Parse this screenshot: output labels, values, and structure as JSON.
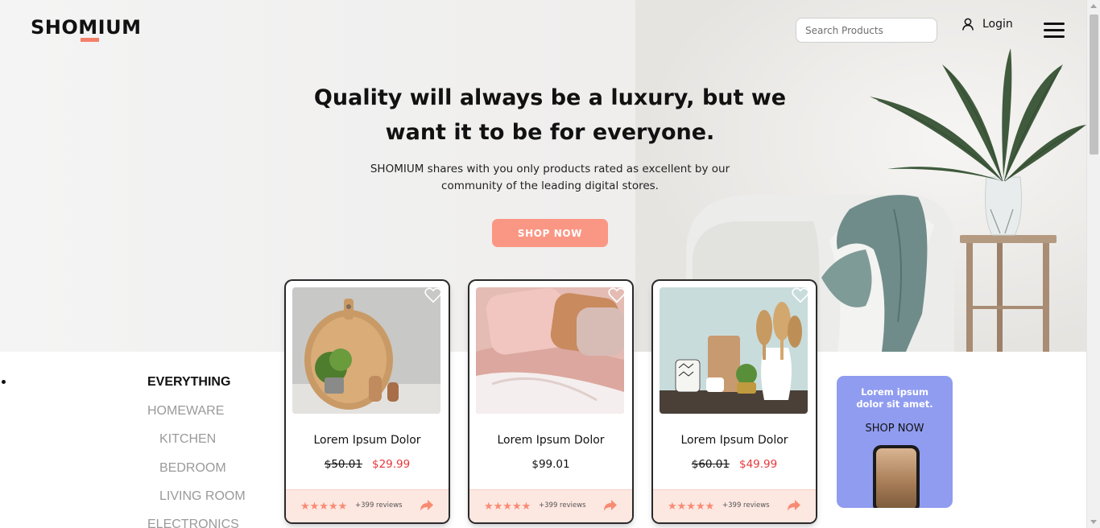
{
  "brand": {
    "name": "SHOMIUM",
    "accent": "#f4806a"
  },
  "header": {
    "search_placeholder": "Search Products",
    "login_label": "Login"
  },
  "hero": {
    "headline": "Quality will always be a luxury, but we want it to be for everyone.",
    "subtext": "SHOMIUM shares with you only products rated as excellent by our community of the leading digital stores.",
    "cta_label": "SHOP NOW",
    "cta_color": "#fa9784"
  },
  "categories": [
    {
      "label": "EVERYTHING",
      "active": true
    },
    {
      "label": "HOMEWARE",
      "active": false
    },
    {
      "label": "KITCHEN",
      "active": false
    },
    {
      "label": "BEDROOM",
      "active": false
    },
    {
      "label": "LIVING ROOM",
      "active": false
    },
    {
      "label": "ELECTRONICS",
      "active": false
    }
  ],
  "products": [
    {
      "title": "Lorem Ipsum Dolor",
      "old_price": "$50.01",
      "price": "$29.99",
      "rating_stars": "★★★★★",
      "reviews": "+399 reviews",
      "image": "cutting-board-plant"
    },
    {
      "title": "Lorem Ipsum Dolor",
      "old_price": "",
      "price": "$99.01",
      "rating_stars": "★★★★★",
      "reviews": "+399 reviews",
      "image": "pink-bedding"
    },
    {
      "title": "Lorem Ipsum Dolor",
      "old_price": "$60.01",
      "price": "$49.99",
      "rating_stars": "★★★★★",
      "reviews": "+399 reviews",
      "image": "kitchen-utensils"
    }
  ],
  "promo": {
    "title": "Lorem ipsum dolor sit amet.",
    "cta_label": "SHOP NOW",
    "background": "#909cf0"
  },
  "icons": {
    "user": "user-icon",
    "menu": "hamburger-menu-icon",
    "heart": "heart-icon",
    "share": "share-arrow-icon"
  },
  "colors": {
    "sale_price": "#e5383b",
    "rating": "#f98b73",
    "card_footer": "#fde7e1"
  }
}
